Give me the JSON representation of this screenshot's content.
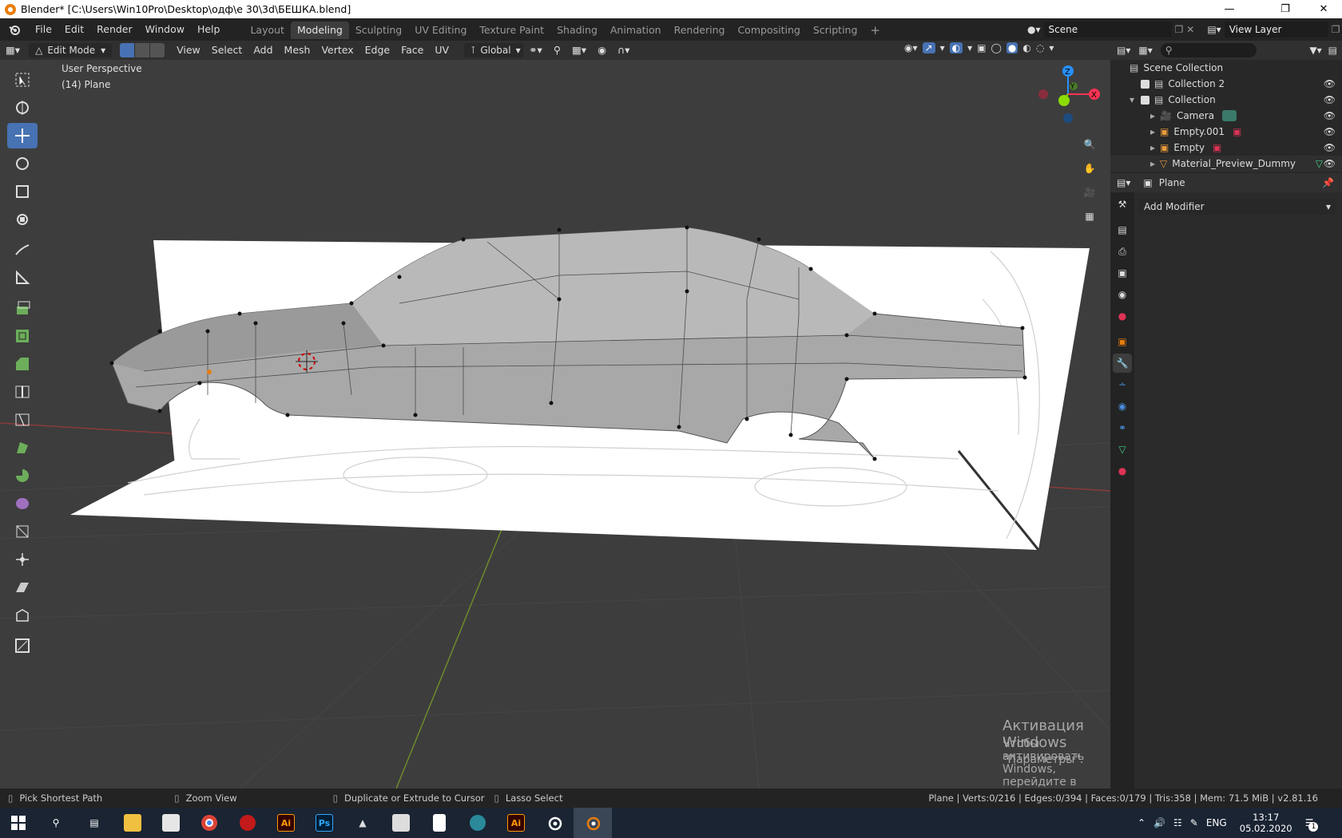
{
  "window": {
    "title": "Blender* [C:\\Users\\Win10Pro\\Desktop\\одф\\е 30\\3d\\БЕШКА.blend]"
  },
  "menu": {
    "items": [
      "File",
      "Edit",
      "Render",
      "Window",
      "Help"
    ]
  },
  "workspaces": {
    "tabs": [
      "Layout",
      "Modeling",
      "Sculpting",
      "UV Editing",
      "Texture Paint",
      "Shading",
      "Animation",
      "Rendering",
      "Compositing",
      "Scripting"
    ],
    "active": "Modeling"
  },
  "scene": {
    "name": "Scene",
    "view_layer": "View Layer"
  },
  "header": {
    "mode": "Edit Mode",
    "menus": [
      "View",
      "Select",
      "Add",
      "Mesh",
      "Vertex",
      "Edge",
      "Face",
      "UV"
    ],
    "orientation": "Global"
  },
  "viewport": {
    "perspective": "User Perspective",
    "object": "(14) Plane",
    "gizmo": {
      "x": "X",
      "y": "Y",
      "z": "Z"
    }
  },
  "watermark": {
    "title": "Активация Windows",
    "line1": "Чтобы активировать Windows, перейдите в раздел",
    "line2": "\"Параметры\"."
  },
  "outliner": {
    "root": "Scene Collection",
    "rows": [
      {
        "label": "Collection 2",
        "icon": "collection-icon"
      },
      {
        "label": "Collection",
        "icon": "collection-icon"
      },
      {
        "label": "Camera",
        "icon": "camera-icon"
      },
      {
        "label": "Empty.001",
        "icon": "empty-icon"
      },
      {
        "label": "Empty",
        "icon": "empty-icon"
      },
      {
        "label": "Material_Preview_Dummy",
        "icon": "mesh-icon"
      }
    ]
  },
  "properties": {
    "object": "Plane",
    "add_modifier": "Add Modifier"
  },
  "status": {
    "hint1": "Pick Shortest Path",
    "hint2": "Zoom View",
    "hint3": "Duplicate or Extrude to Cursor",
    "hint4": "Lasso Select",
    "stats": "Plane | Verts:0/216 | Edges:0/394 | Faces:0/179 | Tris:358 | Mem: 71.5 MiB | v2.81.16"
  },
  "taskbar": {
    "lang": "ENG",
    "time": "13:17",
    "date": "05.02.2020",
    "notifications": "1",
    "ai1": "Ai",
    "ps": "Ps",
    "ai2": "Ai"
  },
  "colors": {
    "accent": "#4772b3",
    "axis_x": "#ff3352",
    "axis_y": "#8bdc00",
    "axis_z": "#2890ff",
    "blender_orange": "#e87d0d"
  }
}
